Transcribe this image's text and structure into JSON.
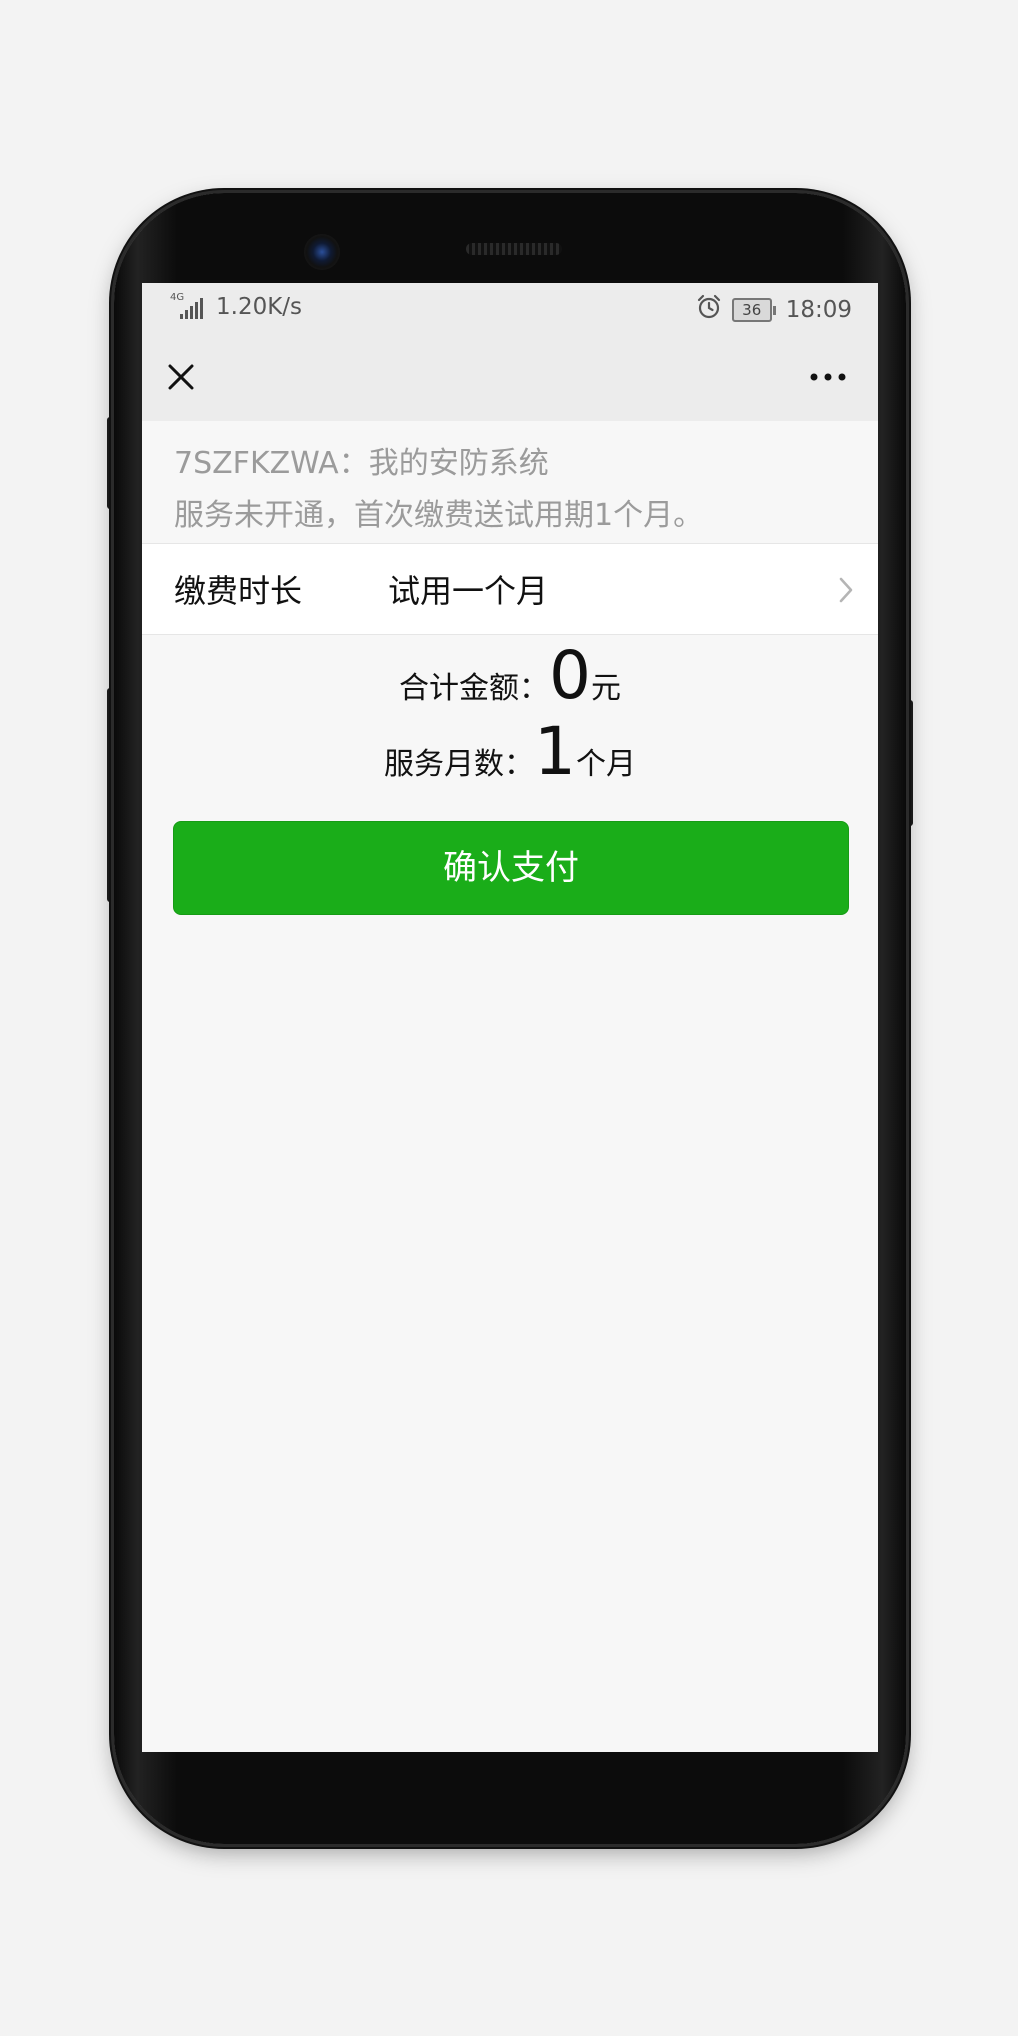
{
  "statusbar": {
    "network": "4G",
    "speed": "1.20K/s",
    "battery": "36",
    "time": "18:09",
    "icons": [
      "signal-icon",
      "alarm-icon",
      "battery-icon"
    ]
  },
  "navbar": {
    "close_icon": "close-icon",
    "more_icon": "more-dots-icon"
  },
  "info": {
    "device_line": "7SZFKZWA：我的安防系统",
    "notice_line": "服务未开通，首次缴费送试用期1个月。"
  },
  "payment_row": {
    "label": "缴费时长",
    "value": "试用一个月"
  },
  "summary": {
    "total_label": "合计金额：",
    "total_value": "0",
    "total_unit": "元",
    "months_label": "服务月数：",
    "months_value": "1",
    "months_unit": "个月"
  },
  "confirm_button": "确认支付",
  "colors": {
    "accent": "#1aad19",
    "bar_bg": "#ececec",
    "page_bg": "#f7f7f7",
    "muted_text": "#9b9b9b"
  }
}
